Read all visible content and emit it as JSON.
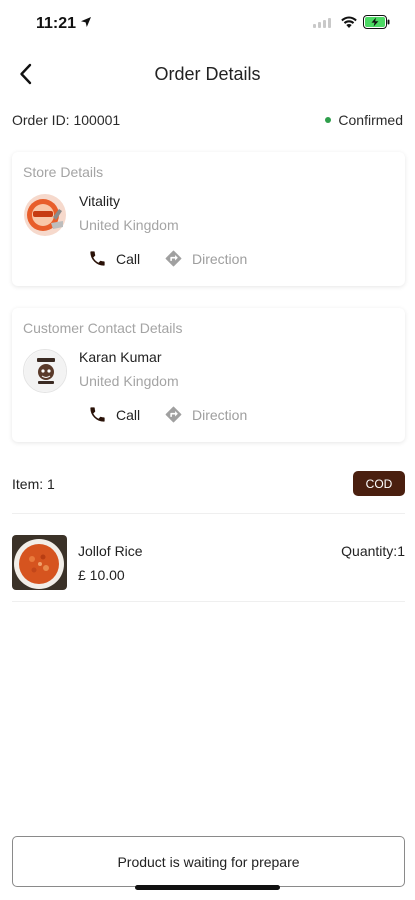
{
  "status_bar": {
    "time": "11:21",
    "icons": [
      "location-arrow-icon",
      "cellular-signal-icon",
      "wifi-icon",
      "battery-charging-icon"
    ],
    "battery_color": "#4cd964"
  },
  "header": {
    "title": "Order Details",
    "back_icon": "chevron-left-icon"
  },
  "order": {
    "id_text": "Order ID: 100001",
    "status": "Confirmed",
    "status_color": "#2e9e4b"
  },
  "store_card": {
    "title": "Store Details",
    "name": "Vitality",
    "location": "United Kingdom",
    "call_label": "Call",
    "direction_label": "Direction",
    "avatar_icon": "store-logo-icon"
  },
  "customer_card": {
    "title": "Customer Contact Details",
    "name": "Karan Kumar",
    "location": "United Kingdom",
    "call_label": "Call",
    "direction_label": "Direction",
    "avatar_icon": "customer-logo-icon"
  },
  "items": {
    "count_text": "Item: 1",
    "payment_badge": "COD",
    "badge_color": "#4a1f0f"
  },
  "products": [
    {
      "name": "Jollof Rice",
      "price": "£ 10.00",
      "quantity_text": "Quantity:1",
      "image_icon": "food-photo-icon"
    }
  ],
  "footer": {
    "button_label": "Product is waiting for prepare"
  }
}
